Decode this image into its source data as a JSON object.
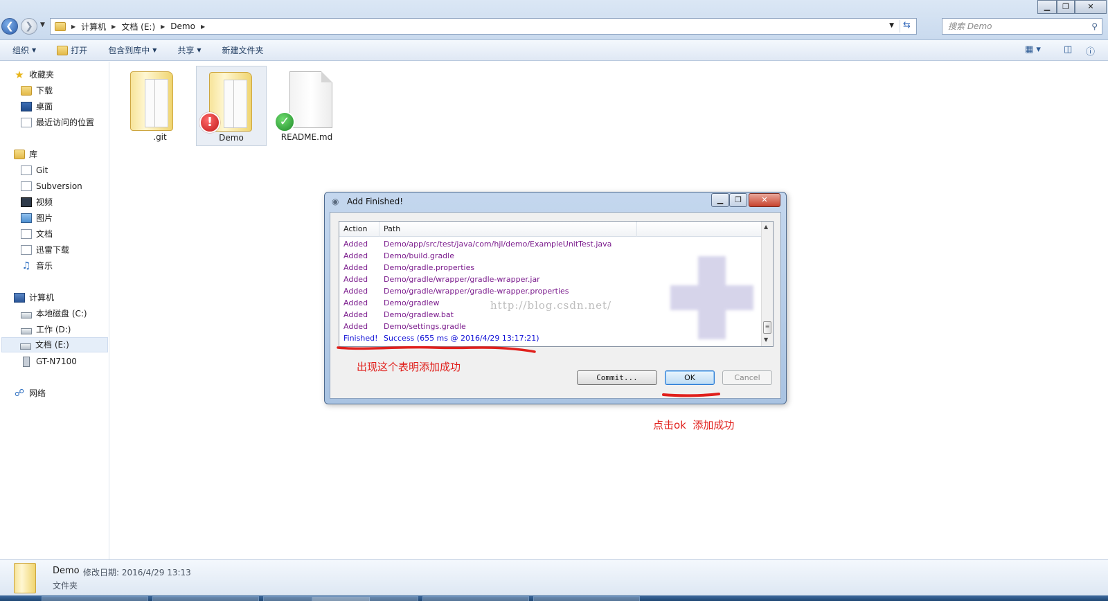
{
  "window": {
    "breadcrumb": [
      "计算机",
      "文档 (E:)",
      "Demo"
    ],
    "search_placeholder": "搜索 Demo",
    "minimize": "▁",
    "maximize": "❐",
    "close": "✕"
  },
  "toolbar": {
    "organize": "组织",
    "open": "打开",
    "include_library": "包含到库中",
    "share": "共享",
    "new_folder": "新建文件夹"
  },
  "sidebar": {
    "favorites": {
      "label": "收藏夹",
      "items": [
        "下载",
        "桌面",
        "最近访问的位置"
      ]
    },
    "libraries": {
      "label": "库",
      "items": [
        "Git",
        "Subversion",
        "视频",
        "图片",
        "文档",
        "迅雷下载",
        "音乐"
      ]
    },
    "computer": {
      "label": "计算机",
      "items": [
        "本地磁盘 (C:)",
        "工作 (D:)",
        "文档 (E:)",
        "GT-N7100"
      ]
    },
    "network": {
      "label": "网络"
    }
  },
  "files": [
    {
      "name": ".git",
      "type": "folder",
      "overlay": "none"
    },
    {
      "name": "Demo",
      "type": "folder",
      "overlay": "error"
    },
    {
      "name": "README.md",
      "type": "file",
      "overlay": "ok"
    }
  ],
  "dialog": {
    "title": "Add Finished!",
    "columns": [
      "Action",
      "Path"
    ],
    "rows": [
      {
        "action": "Added",
        "path": "Demo/app/src/test/java/com/hjl/demo/ExampleUnitTest.java"
      },
      {
        "action": "Added",
        "path": "Demo/build.gradle"
      },
      {
        "action": "Added",
        "path": "Demo/gradle.properties"
      },
      {
        "action": "Added",
        "path": "Demo/gradle/wrapper/gradle-wrapper.jar"
      },
      {
        "action": "Added",
        "path": "Demo/gradle/wrapper/gradle-wrapper.properties"
      },
      {
        "action": "Added",
        "path": "Demo/gradlew"
      },
      {
        "action": "Added",
        "path": "Demo/gradlew.bat"
      },
      {
        "action": "Added",
        "path": "Demo/settings.gradle"
      },
      {
        "action": "Finished!",
        "path": "Success (655 ms @ 2016/4/29 13:17:21)"
      }
    ],
    "watermark": "http://blog.csdn.net/",
    "buttons": {
      "commit": "Commit...",
      "ok": "OK",
      "cancel": "Cancel"
    }
  },
  "annotations": {
    "note1": "出现这个表明添加成功",
    "note2": "点击ok  添加成功"
  },
  "details": {
    "name": "Demo",
    "modified": "修改日期: 2016/4/29 13:13",
    "type": "文件夹"
  },
  "colors": {
    "added_text": "#7a1a8c",
    "finished_text": "#1010d6",
    "annotation_red": "#e0201c"
  }
}
